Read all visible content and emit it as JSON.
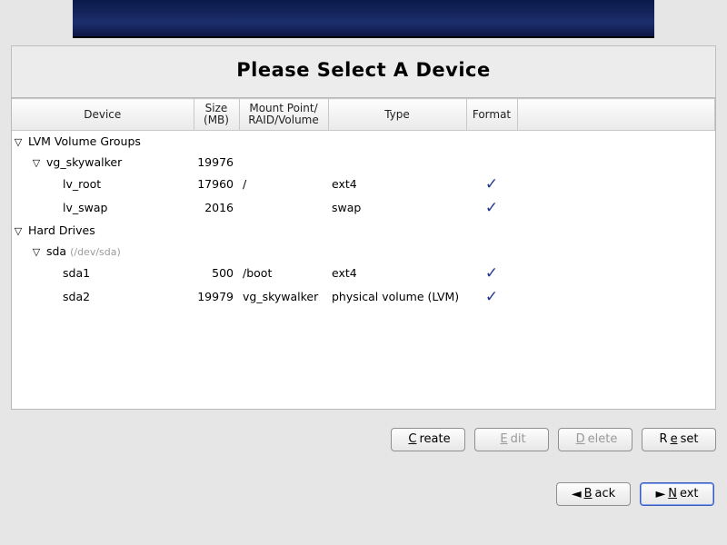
{
  "title": "Please Select A Device",
  "columns": {
    "device": "Device",
    "size": "Size\n(MB)",
    "mount": "Mount Point/\nRAID/Volume",
    "type": "Type",
    "format": "Format"
  },
  "sections": {
    "lvm_title": "LVM Volume Groups",
    "hd_title": "Hard Drives"
  },
  "vg": {
    "name": "vg_skywalker",
    "size": "19976",
    "rows": [
      {
        "name": "lv_root",
        "size": "17960",
        "mount": "/",
        "type": "ext4",
        "format": true
      },
      {
        "name": "lv_swap",
        "size": "2016",
        "mount": "",
        "type": "swap",
        "format": true
      }
    ]
  },
  "hd": {
    "name": "sda",
    "path": "(/dev/sda)",
    "rows": [
      {
        "name": "sda1",
        "size": "500",
        "mount": "/boot",
        "type": "ext4",
        "format": true
      },
      {
        "name": "sda2",
        "size": "19979",
        "mount": "vg_skywalker",
        "type": "physical volume (LVM)",
        "format": true
      }
    ]
  },
  "buttons": {
    "create_pre": "",
    "create_u": "C",
    "create_post": "reate",
    "edit_pre": "",
    "edit_u": "E",
    "edit_post": "dit",
    "delete_pre": "",
    "delete_u": "D",
    "delete_post": "elete",
    "reset_pre": "R",
    "reset_u": "e",
    "reset_post": "set",
    "back_u": "B",
    "back_post": "ack",
    "next_u": "N",
    "next_post": "ext"
  }
}
